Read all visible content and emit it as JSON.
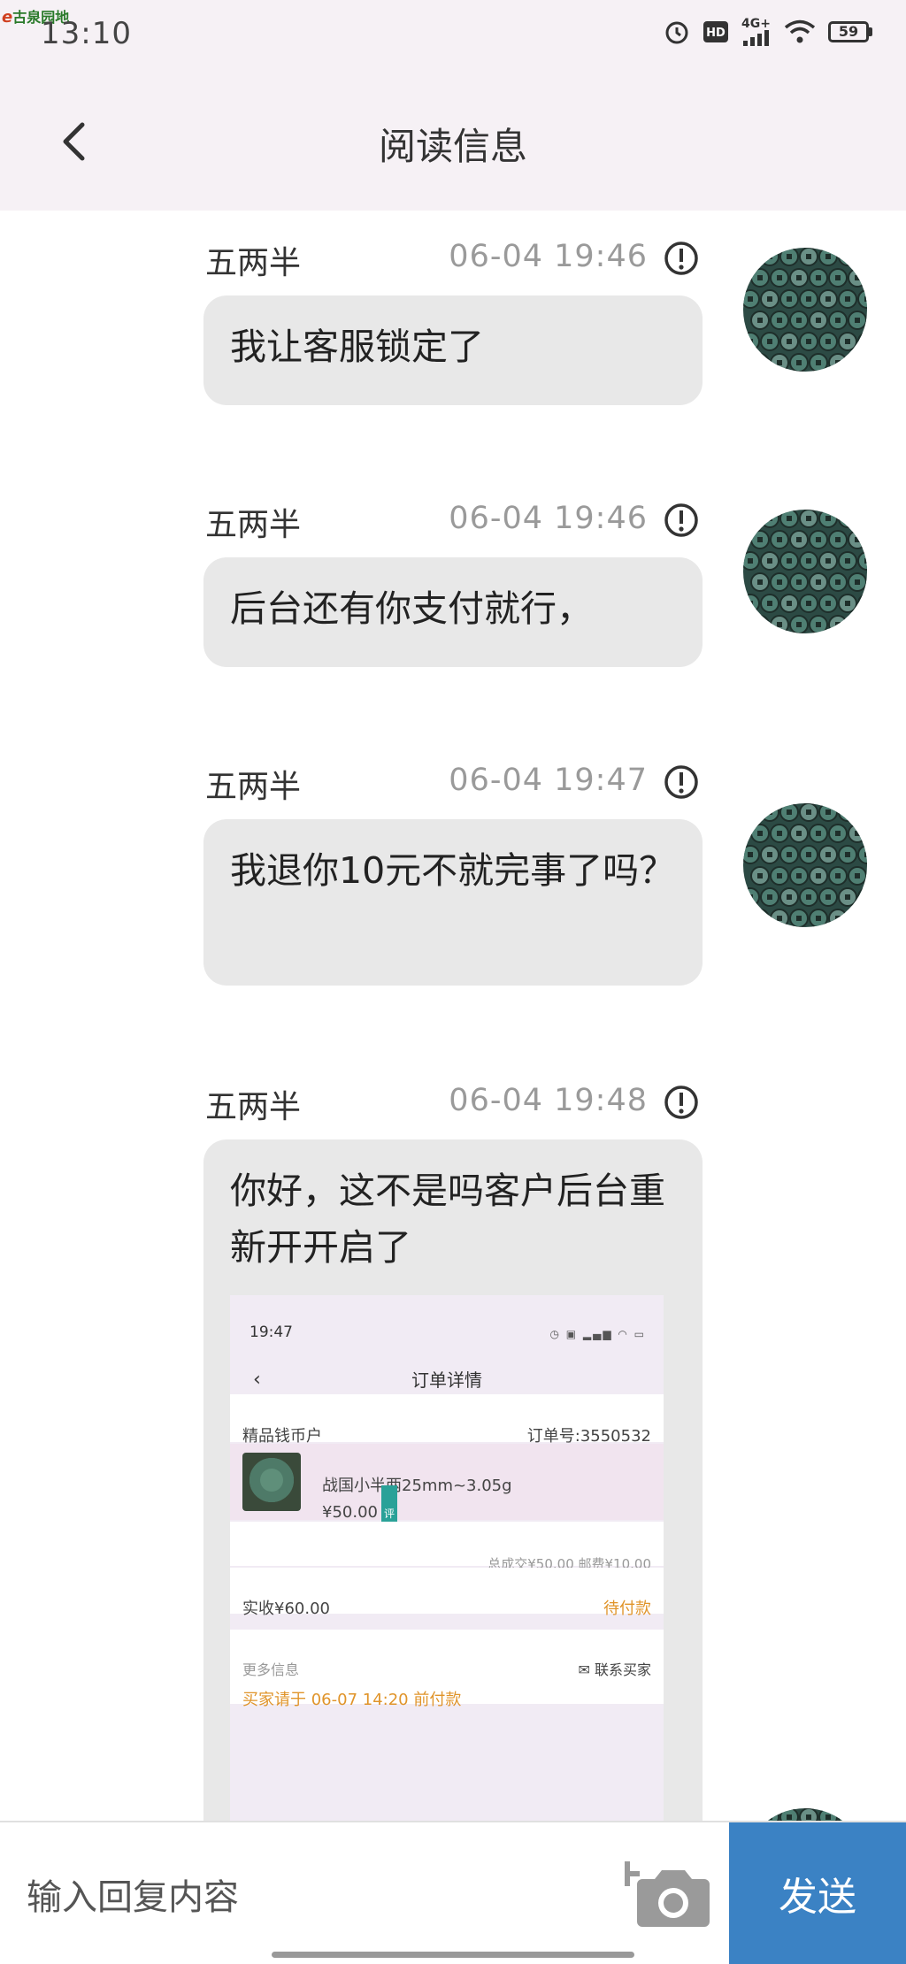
{
  "status_bar": {
    "time": "13:10",
    "watermark": "古泉园地",
    "battery": "59",
    "network": "4G+"
  },
  "header": {
    "title": "阅读信息"
  },
  "messages": [
    {
      "sender": "五两半",
      "time": "06-04 19:46",
      "text": "我让客服锁定了"
    },
    {
      "sender": "五两半",
      "time": "06-04 19:46",
      "text": "后台还有你支付就行，"
    },
    {
      "sender": "五两半",
      "time": "06-04 19:47",
      "text": "我退你10元不就完事了吗？"
    },
    {
      "sender": "五两半",
      "time": "06-04 19:48",
      "text": "你好，这不是吗客户后台重新开开启了"
    }
  ],
  "attached_screenshot": {
    "time": "19:47",
    "title": "订单详情",
    "shop": "精品钱币户",
    "order_no": "订单号:3550532",
    "product_name": "战国小半两25mm~3.05g",
    "price": "¥50.00",
    "tag": "评",
    "totals": "总成交¥50.00   邮费¥10.00",
    "received": "实收¥60.00",
    "status": "待付款",
    "more_info": "更多信息",
    "contact": "联系买家",
    "deadline": "买家请于 06-07 14:20 前付款"
  },
  "input_bar": {
    "placeholder": "输入回复内容",
    "send_label": "发送"
  },
  "colors": {
    "header_bg": "#f6f1f5",
    "bubble_bg": "#e8e8e8",
    "send_button": "#3b82c4",
    "accent_orange": "#e0942a"
  }
}
